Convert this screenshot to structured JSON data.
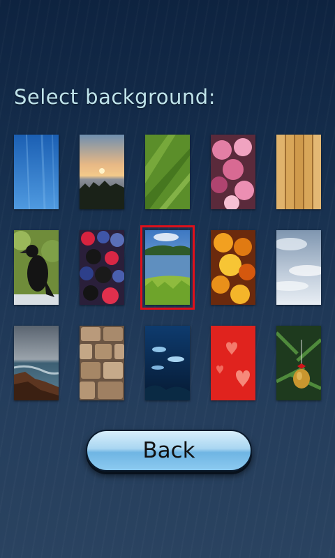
{
  "title": "Select background:",
  "back_label": "Back",
  "selected_index": 7,
  "colors": {
    "title": "#bfe3ea",
    "selection_border": "#e0101a",
    "button_fill": "#a9d6f1"
  },
  "thumbnails": [
    {
      "name": "blue-streaks"
    },
    {
      "name": "sunset-sea"
    },
    {
      "name": "green-leaf"
    },
    {
      "name": "pink-blossoms"
    },
    {
      "name": "wooden-planks"
    },
    {
      "name": "black-raven"
    },
    {
      "name": "berries"
    },
    {
      "name": "lake-landscape"
    },
    {
      "name": "autumn-leaves"
    },
    {
      "name": "cloudy-sky"
    },
    {
      "name": "rocky-coast"
    },
    {
      "name": "stone-wall"
    },
    {
      "name": "underwater-fish"
    },
    {
      "name": "red-hearts"
    },
    {
      "name": "christmas-walnut"
    }
  ]
}
